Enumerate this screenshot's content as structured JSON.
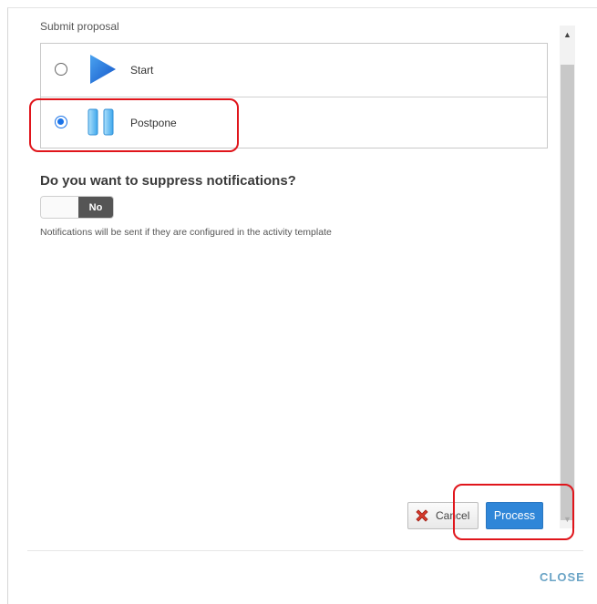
{
  "dialog": {
    "section_title": "Submit proposal",
    "options": [
      {
        "label": "Start",
        "icon": "play-icon",
        "selected": false
      },
      {
        "label": "Postpone",
        "icon": "pause-icon",
        "selected": true
      }
    ],
    "question": "Do you want to suppress notifications?",
    "toggle_value": "No",
    "note": "Notifications will be sent if they are configured in the activity template"
  },
  "buttons": {
    "cancel_label": "Cancel",
    "process_label": "Process",
    "close_label": "CLOSE"
  },
  "colors": {
    "accent": "#2f86d8",
    "highlight": "#e0151b",
    "close_link": "#6aa4c6"
  }
}
